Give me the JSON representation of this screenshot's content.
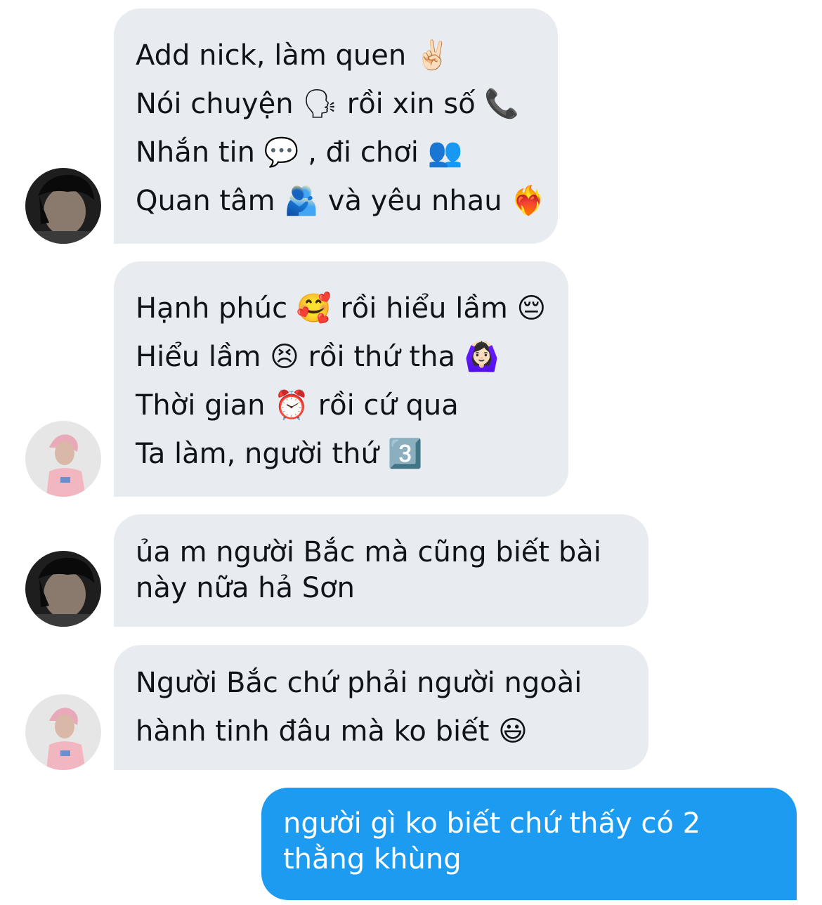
{
  "conversation": {
    "messages": [
      {
        "direction": "incoming",
        "sender": "dark-hair-user",
        "lines": [
          "Add nick, làm quen ✌🏻",
          "Nói chuyện 🗣  rồi xin số 📞",
          "Nhắn tin 💬 , đi chơi 👥",
          "Quan tâm 🫂  và yêu nhau ❤️‍🔥"
        ]
      },
      {
        "direction": "incoming",
        "sender": "pink-hair-user",
        "lines": [
          "Hạnh phúc 🥰  rồi hiểu lầm 😔",
          "Hiểu lầm 😣  rồi thứ tha 🙆🏻‍♀️",
          "Thời gian ⏰  rồi cứ qua",
          "Ta làm, người thứ 3️⃣"
        ]
      },
      {
        "direction": "incoming",
        "sender": "dark-hair-user",
        "lines": [
          "ủa m người Bắc mà cũng biết bài",
          "này nữa hả Sơn"
        ]
      },
      {
        "direction": "incoming",
        "sender": "pink-hair-user",
        "lines": [
          "Người Bắc chứ phải người ngoài",
          "hành tinh đâu mà ko biết 😃"
        ]
      },
      {
        "direction": "outgoing",
        "sender": "me",
        "lines": [
          "người gì ko biết chứ thấy có 2",
          "thằng khùng"
        ]
      }
    ]
  },
  "colors": {
    "incoming_bubble": "#e8ecf0",
    "outgoing_bubble": "#1d9bf0",
    "incoming_text": "#0f1419",
    "outgoing_text": "#ffffff"
  }
}
